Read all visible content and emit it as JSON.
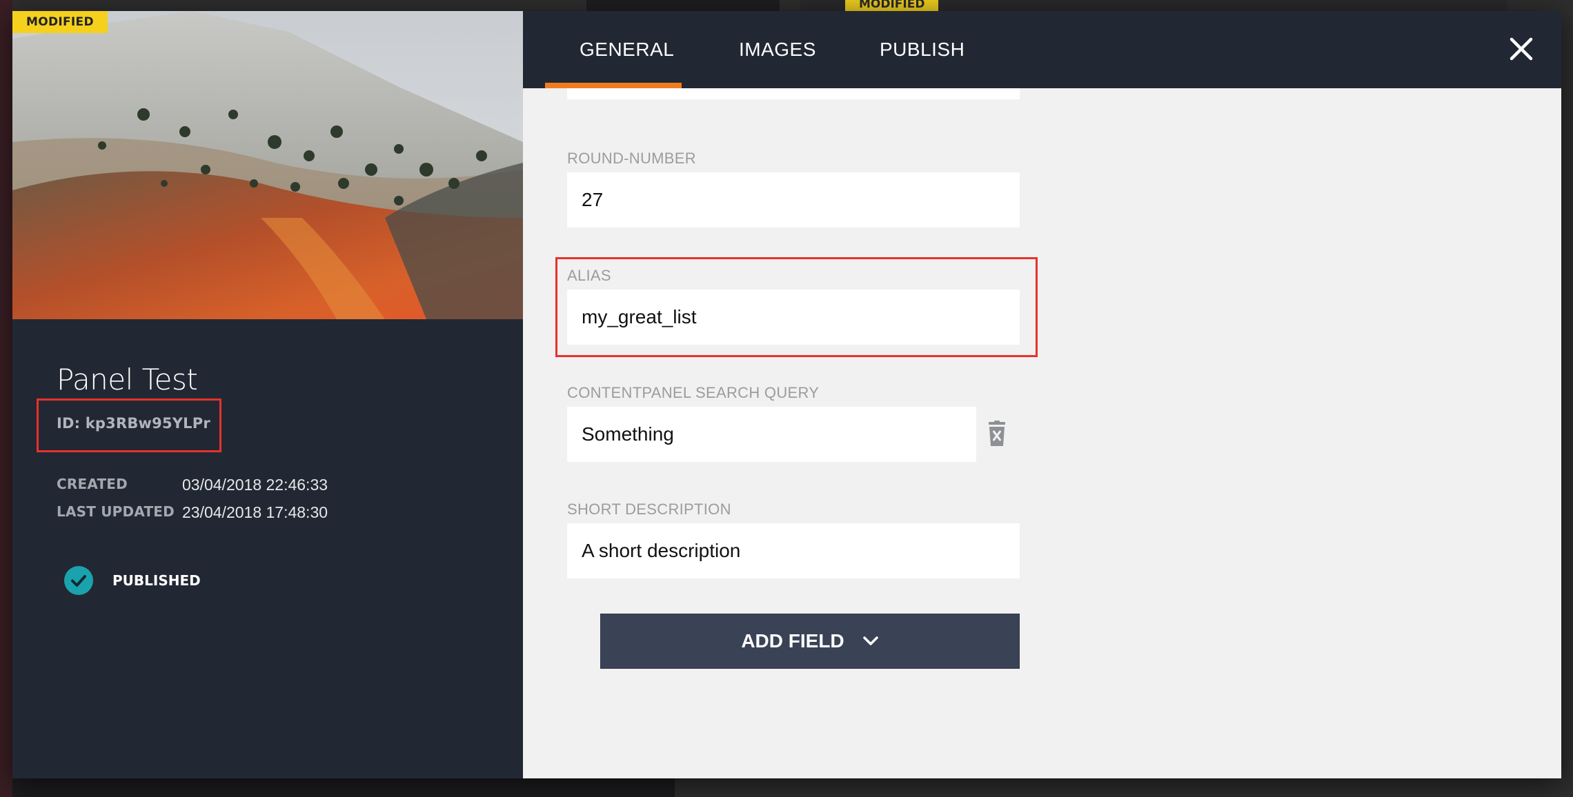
{
  "background": {
    "card_badge": "MODIFIED"
  },
  "modal": {
    "badge": "MODIFIED",
    "title": "Panel Test",
    "id_text": "ID: kp3RBw95YLPr",
    "meta": [
      {
        "label": "CREATED",
        "value": "03/04/2018 22:46:33"
      },
      {
        "label": "LAST UPDATED",
        "value": "23/04/2018 17:48:30"
      }
    ],
    "status": {
      "label": "PUBLISHED",
      "icon": "check-circle-icon",
      "color": "#1aa3ad"
    },
    "tabs": [
      {
        "label": "GENERAL",
        "active": true
      },
      {
        "label": "IMAGES",
        "active": false
      },
      {
        "label": "PUBLISH",
        "active": false
      }
    ],
    "accent_color": "#ef7d20",
    "highlight_color": "#e8312a",
    "fields": [
      {
        "label": "ROUND-NUMBER",
        "value": "27"
      },
      {
        "label": "ALIAS",
        "value": "my_great_list"
      },
      {
        "label": "CONTENTPANEL SEARCH QUERY",
        "value": "Something"
      },
      {
        "label": "SHORT DESCRIPTION",
        "value": "A short description"
      }
    ],
    "add_field_label": "ADD FIELD"
  }
}
